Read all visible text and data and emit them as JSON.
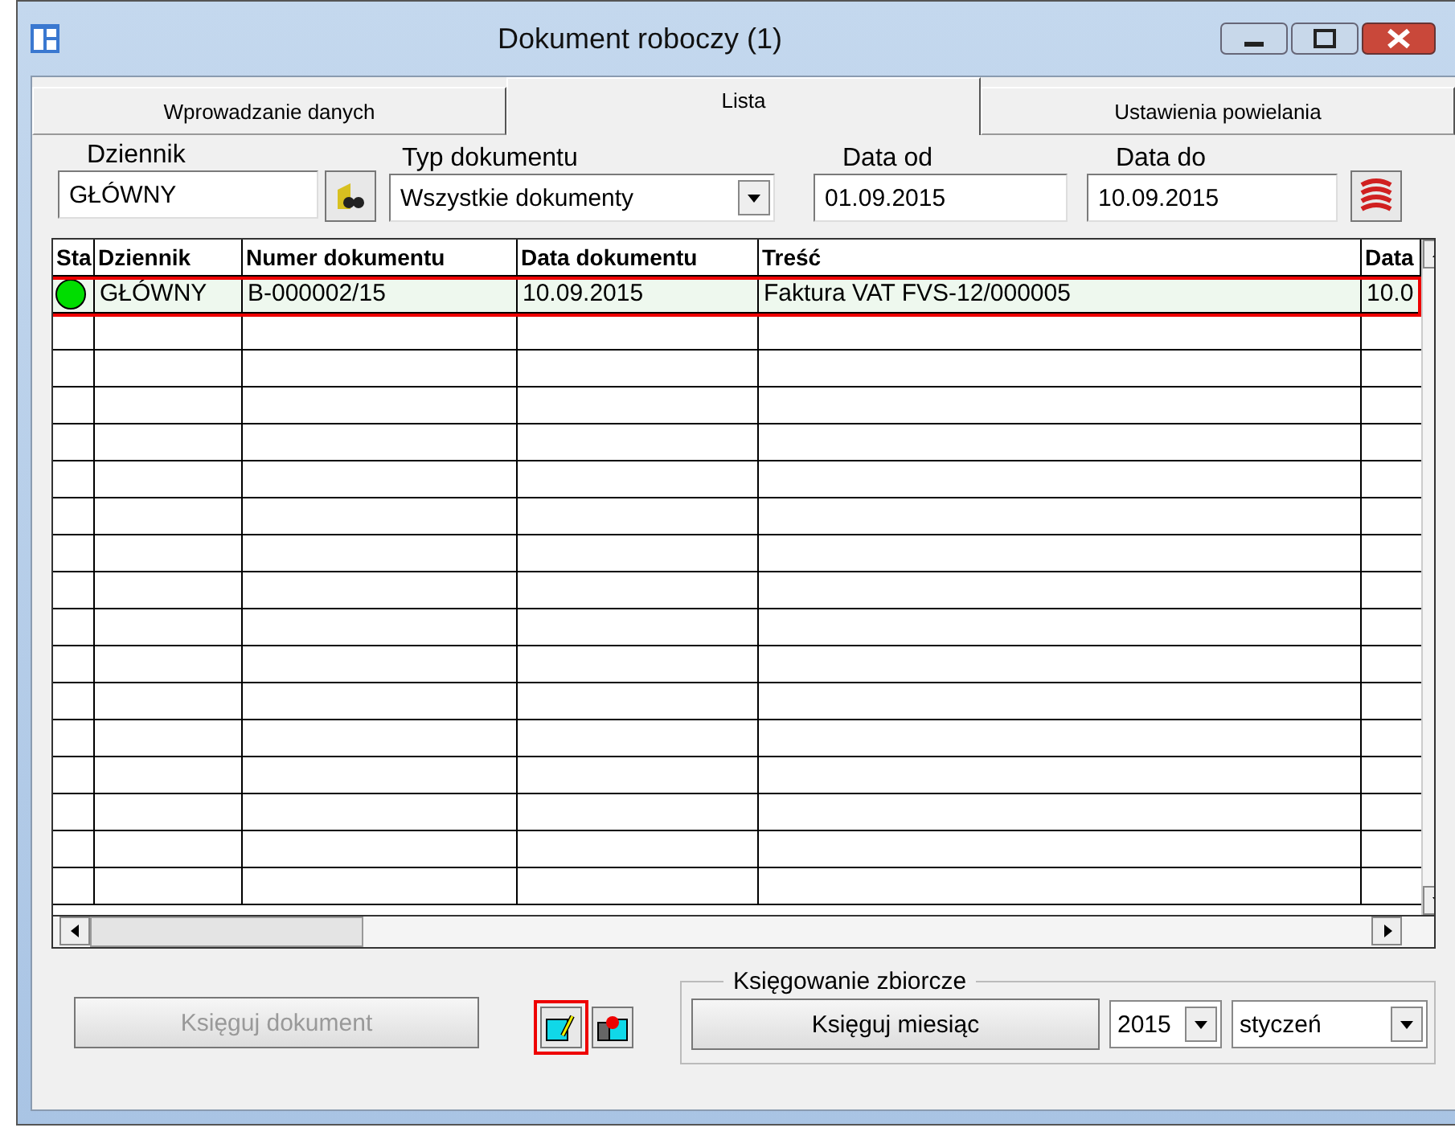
{
  "window": {
    "title": "Dokument roboczy (1)"
  },
  "tabs": [
    {
      "label": "Wprowadzanie danych",
      "selected": false
    },
    {
      "label": "Lista",
      "selected": true
    },
    {
      "label": "Ustawienia powielania",
      "selected": false
    }
  ],
  "filters": {
    "journal": {
      "label": "Dziennik",
      "value": "GŁÓWNY"
    },
    "doc_type": {
      "label": "Typ dokumentu",
      "value": "Wszystkie dokumenty"
    },
    "date_from": {
      "label": "Data od",
      "value": "01.09.2015"
    },
    "date_to": {
      "label": "Data do",
      "value": "10.09.2015"
    }
  },
  "table": {
    "columns": [
      "Sta",
      "Dziennik",
      "Numer dokumentu",
      "Data dokumentu",
      "Treść",
      "Data"
    ],
    "rows": [
      {
        "color": "#00dd00",
        "highlighted": true,
        "cells": [
          "",
          "GŁÓWNY",
          "B-000002/15",
          "10.09.2015",
          "Faktura VAT FVS-12/000005",
          "10.0"
        ]
      }
    ]
  },
  "bottom": {
    "post_button": {
      "label": "Księguj dokument",
      "disabled": true
    },
    "edit_icon": {
      "highlighted": true
    },
    "group": {
      "title": "Księgowanie zbiorcze",
      "button": "Księguj miesiąc",
      "year": "2015",
      "month": "styczeń"
    }
  }
}
